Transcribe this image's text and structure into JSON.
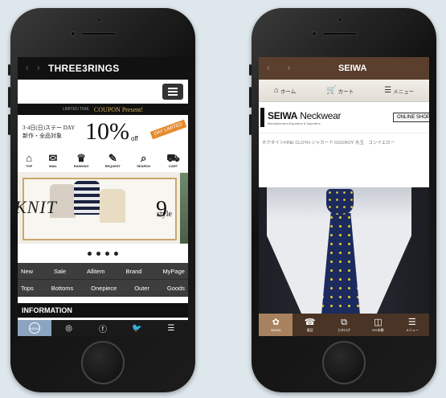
{
  "left_app": {
    "title": "THREE3RINGS",
    "nav_back": "‹",
    "nav_forward": "›",
    "coupon_strip": {
      "subtitle": "LIMITED TIME",
      "title": "COUPON Present!"
    },
    "coupon_banner": {
      "text_line1": "3·4日(日)ステー DAY",
      "text_line2": "新作・全品対象",
      "percent": "10%",
      "off": "off",
      "tag": "DAY LIMITED"
    },
    "icons": [
      {
        "glyph": "⌂",
        "label": "TOP",
        "icon": "home-icon"
      },
      {
        "glyph": "✉",
        "label": "MAIL",
        "icon": "mail-icon"
      },
      {
        "glyph": "♛",
        "label": "RANKING",
        "icon": "crown-icon"
      },
      {
        "glyph": "✎",
        "label": "REQUEST",
        "icon": "request-icon"
      },
      {
        "glyph": "⌕",
        "label": "SEARCH",
        "icon": "search-icon"
      },
      {
        "glyph": "⛟",
        "label": "CART",
        "icon": "cart-icon"
      }
    ],
    "hero": {
      "left_text": "KNIT",
      "number": "9",
      "style": "style"
    },
    "categories_row1": [
      "New",
      "Sale",
      "Allitem",
      "Brand",
      "MyPage"
    ],
    "categories_row2": [
      "Tops",
      "Bottoms",
      "Onepiece",
      "Outer",
      "Goods"
    ],
    "section_title": "INFORMATION",
    "tabs": [
      {
        "glyph": "MENU",
        "icon": "app-logo-icon"
      },
      {
        "glyph": "◎",
        "icon": "instagram-icon"
      },
      {
        "glyph": "ⓕ",
        "icon": "facebook-icon"
      },
      {
        "glyph": "🐦",
        "icon": "twitter-icon"
      },
      {
        "glyph": "☰",
        "icon": "menu-icon"
      }
    ]
  },
  "right_app": {
    "title": "SEIWA",
    "nav_back": "‹",
    "nav_forward": "›",
    "nav": [
      {
        "glyph": "⌂",
        "label": "ホーム",
        "icon": "home-icon"
      },
      {
        "glyph": "🛒",
        "label": "カート",
        "icon": "cart-icon"
      },
      {
        "glyph": "☰",
        "label": "メニュー",
        "icon": "menu-icon"
      }
    ],
    "brand": {
      "name_bold": "SEIWA",
      "name_light": " Neckwear",
      "tagline": "Manufacturers,Exporters & Importers",
      "shop_button": "ONLINE SHOP"
    },
    "breadcrumb": "ネクタイ＞FINE CLOTH ジャカード 0101ROY 水玉　コンイエロー",
    "tabs": [
      {
        "glyph": "✿",
        "label": "SEIWA",
        "icon": "seiwa-logo-icon"
      },
      {
        "glyph": "☎",
        "label": "電話",
        "icon": "phone-icon"
      },
      {
        "glyph": "⧉",
        "label": "カタログ",
        "icon": "catalog-icon"
      },
      {
        "glyph": "◫",
        "label": "MY本棚",
        "icon": "bookshelf-icon"
      },
      {
        "glyph": "☰",
        "label": "メニュー",
        "icon": "menu-icon"
      }
    ]
  }
}
